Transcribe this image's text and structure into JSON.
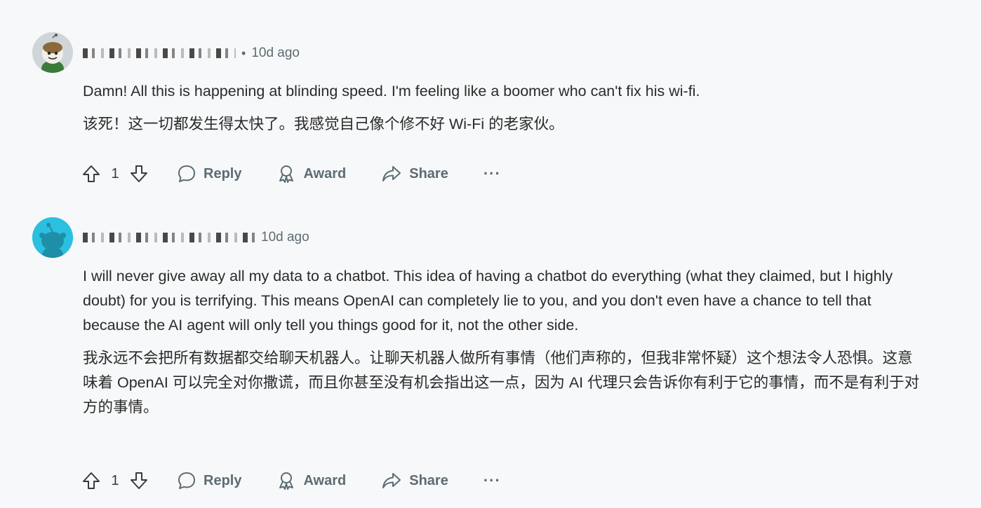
{
  "comments": [
    {
      "time": "10d ago",
      "text_en": "Damn! All this is happening at blinding speed. I'm feeling like a boomer who can't fix his wi-fi.",
      "text_zh": "该死！这一切都发生得太快了。我感觉自己像个修不好 Wi-Fi 的老家伙。",
      "vote_count": "1",
      "reply_label": "Reply",
      "award_label": "Award",
      "share_label": "Share",
      "more_label": "···"
    },
    {
      "time": "10d ago",
      "text_en": "I will never give away all my data to a chatbot. This idea of having a chatbot do everything (what they claimed, but I highly doubt) for you is terrifying. This means OpenAI can completely lie to you, and you don't even have a chance to tell that because the AI agent will only tell you things good for it, not the other side.",
      "text_zh": "我永远不会把所有数据都交给聊天机器人。让聊天机器人做所有事情（他们声称的，但我非常怀疑）这个想法令人恐惧。这意味着 OpenAI 可以完全对你撒谎，而且你甚至没有机会指出这一点，因为 AI 代理只会告诉你有利于它的事情，而不是有利于对方的事情。",
      "vote_count": "1",
      "reply_label": "Reply",
      "award_label": "Award",
      "share_label": "Share",
      "more_label": "···"
    }
  ],
  "icons": {
    "upvote": "arrow-up-icon",
    "downvote": "arrow-down-icon",
    "reply": "speech-bubble-icon",
    "award": "award-ribbon-icon",
    "share": "share-arrow-icon"
  },
  "colors": {
    "background": "#f7f8f9",
    "meta_text": "#5c6c74",
    "body_text": "#2a2a2a",
    "avatar2_bg": "#2bc0e0"
  }
}
